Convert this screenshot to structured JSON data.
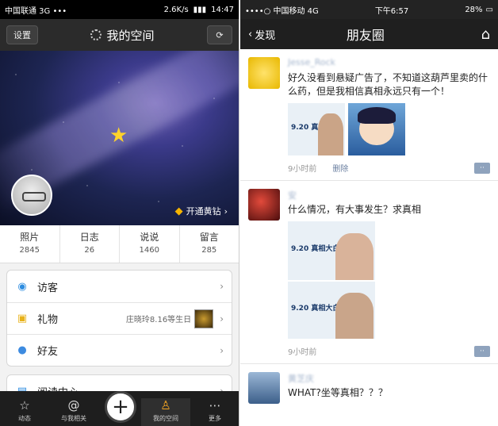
{
  "left": {
    "status": {
      "carrier": "中国联通 3G •••",
      "speed": "2.6K/s",
      "time": "14:47"
    },
    "header": {
      "settings": "设置",
      "title": "我的空间",
      "refresh": "⟳"
    },
    "cover": {
      "vip": "开通黄钻"
    },
    "stats": [
      {
        "label": "照片",
        "value": "2845"
      },
      {
        "label": "日志",
        "value": "26"
      },
      {
        "label": "说说",
        "value": "1460"
      },
      {
        "label": "留言",
        "value": "285"
      }
    ],
    "menu1": [
      {
        "icon": "eye-icon",
        "label": "访客",
        "extra": ""
      },
      {
        "icon": "gift-icon",
        "label": "礼物",
        "extra": "庄晓玲8.16等生日"
      },
      {
        "icon": "friend-icon",
        "label": "好友",
        "extra": ""
      }
    ],
    "menu2": [
      {
        "icon": "book-icon",
        "label": "阅读中心"
      }
    ],
    "tabs": [
      {
        "label": "动态",
        "icon": "star-icon"
      },
      {
        "label": "与我相关",
        "icon": "at-icon"
      },
      {
        "label": "我的空间",
        "icon": "person-icon"
      },
      {
        "label": "更多",
        "icon": "more-icon"
      }
    ]
  },
  "right": {
    "status": {
      "carrier": "••••○ 中国移动  4G",
      "time": "下午6:57",
      "battery": "28%"
    },
    "header": {
      "back": "发现",
      "title": "朋友圈"
    },
    "posts": [
      {
        "name": "Jesse_Rock",
        "text": "好久没看到悬疑广告了，不知道这葫芦里卖的什么药，但是我相信真相永远只有一个！",
        "time": "9小时前",
        "delete": "删除",
        "ad_text": "9.20 真相大白"
      },
      {
        "name": "安",
        "text": "什么情况，有大事发生？求真相",
        "time": "9小时前",
        "ad_text1": "9.20 真相大白",
        "ad_text2": "9.20 真相大白"
      },
      {
        "name": "黄芝庆",
        "text": "WHAT?坐等真相？？？"
      }
    ]
  }
}
